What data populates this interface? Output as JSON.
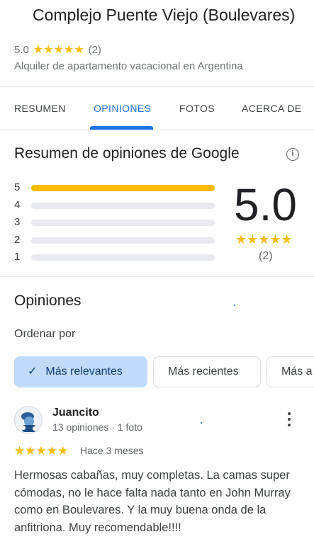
{
  "place": {
    "title": "Complejo Puente Viejo (Boulevares)",
    "rating": "5.0",
    "stars": "★★★★★",
    "review_count": "(2)",
    "category": "Alquiler de apartamento vacacional en Argentina"
  },
  "tabs": [
    {
      "label": "RESUMEN",
      "active": false
    },
    {
      "label": "OPINIONES",
      "active": true
    },
    {
      "label": "FOTOS",
      "active": false
    },
    {
      "label": "ACERCA DE",
      "active": false
    }
  ],
  "summary": {
    "title": "Resumen de opiniones de Google",
    "info_icon": "info-icon",
    "bars": [
      {
        "label": "5",
        "fraction": 1.0
      },
      {
        "label": "4",
        "fraction": 0
      },
      {
        "label": "3",
        "fraction": 0
      },
      {
        "label": "2",
        "fraction": 0
      },
      {
        "label": "1",
        "fraction": 0
      }
    ],
    "score": "5.0",
    "stars": "★★★★★",
    "count": "(2)"
  },
  "reviews_section": {
    "title": "Opiniones",
    "sort_label": "Ordenar por",
    "chips": [
      {
        "label": "Más relevantes",
        "selected": true
      },
      {
        "label": "Más recientes",
        "selected": false
      },
      {
        "label": "Más a",
        "selected": false
      }
    ]
  },
  "review": {
    "author": "Juancito",
    "meta": "13 opiniones · 1 foto",
    "stars": "★★★★★",
    "rating": 5,
    "time": "Hace 3 meses",
    "text": "Hermosas cabañas, muy completas. La camas super cómodas, no le hace falta nada tanto en John Murray como en Boulevares. Y la muy buena onda de la anfitriona. Muy recomendable!!!!"
  },
  "colors": {
    "accent": "#1a73e8",
    "star": "#fbbc04",
    "chip_selected": "#c2dbfb"
  }
}
